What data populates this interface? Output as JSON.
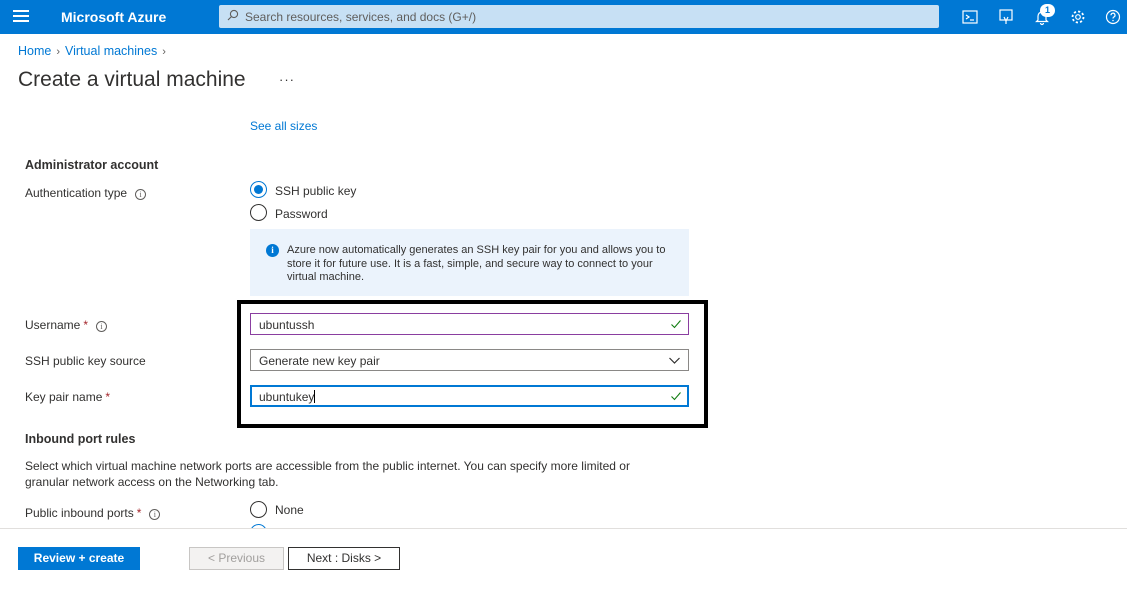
{
  "header": {
    "brand": "Microsoft Azure",
    "search_placeholder": "Search resources, services, and docs (G+/)",
    "notification_count": "1",
    "icons": [
      "menu-icon",
      "search-icon",
      "cloud-shell-icon",
      "directory-filter-icon",
      "notifications-icon",
      "settings-icon",
      "help-icon"
    ]
  },
  "breadcrumb": {
    "items": [
      "Home",
      "Virtual machines"
    ]
  },
  "page": {
    "title": "Create a virtual machine",
    "more": "···"
  },
  "size": {
    "see_all_sizes": "See all sizes"
  },
  "admin": {
    "section_title": "Administrator account",
    "auth_label": "Authentication type",
    "auth_options": [
      "SSH public key",
      "Password"
    ],
    "auth_selected": "SSH public key",
    "info_text": "Azure now automatically generates an SSH key pair for you and allows you to store it for future use. It is a fast, simple, and secure way to connect to your virtual machine.",
    "username_label": "Username",
    "username_value": "ubuntussh",
    "ssh_source_label": "SSH public key source",
    "ssh_source_value": "Generate new key pair",
    "keypair_label": "Key pair name",
    "keypair_value": "ubuntukey",
    "required_mark": "*"
  },
  "inbound": {
    "section_title": "Inbound port rules",
    "description": "Select which virtual machine network ports are accessible from the public internet. You can specify more limited or granular network access on the Networking tab.",
    "ports_label": "Public inbound ports",
    "options": [
      "None"
    ]
  },
  "footer": {
    "review_create": "Review + create",
    "previous": "< Previous",
    "next": "Next : Disks >"
  },
  "colors": {
    "azure_blue": "#0078d4",
    "info_bg": "#ebf3fc",
    "valid_green": "#107c10",
    "required_red": "#a4262c"
  }
}
